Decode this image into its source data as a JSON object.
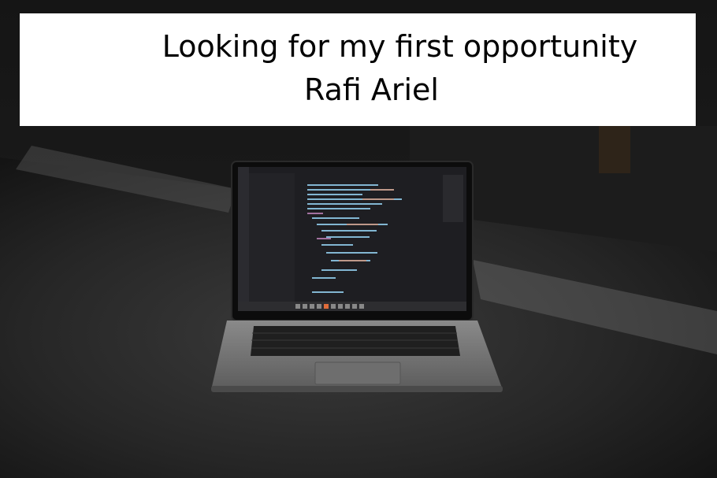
{
  "banner": {
    "headline": "Looking for my first opportunity",
    "name": "Rafi Ariel"
  },
  "photo": {
    "subject": "laptop-with-code-editor"
  },
  "colors": {
    "banner_bg": "#ffffff",
    "banner_text": "#000000",
    "background": "#1a1a1a"
  }
}
